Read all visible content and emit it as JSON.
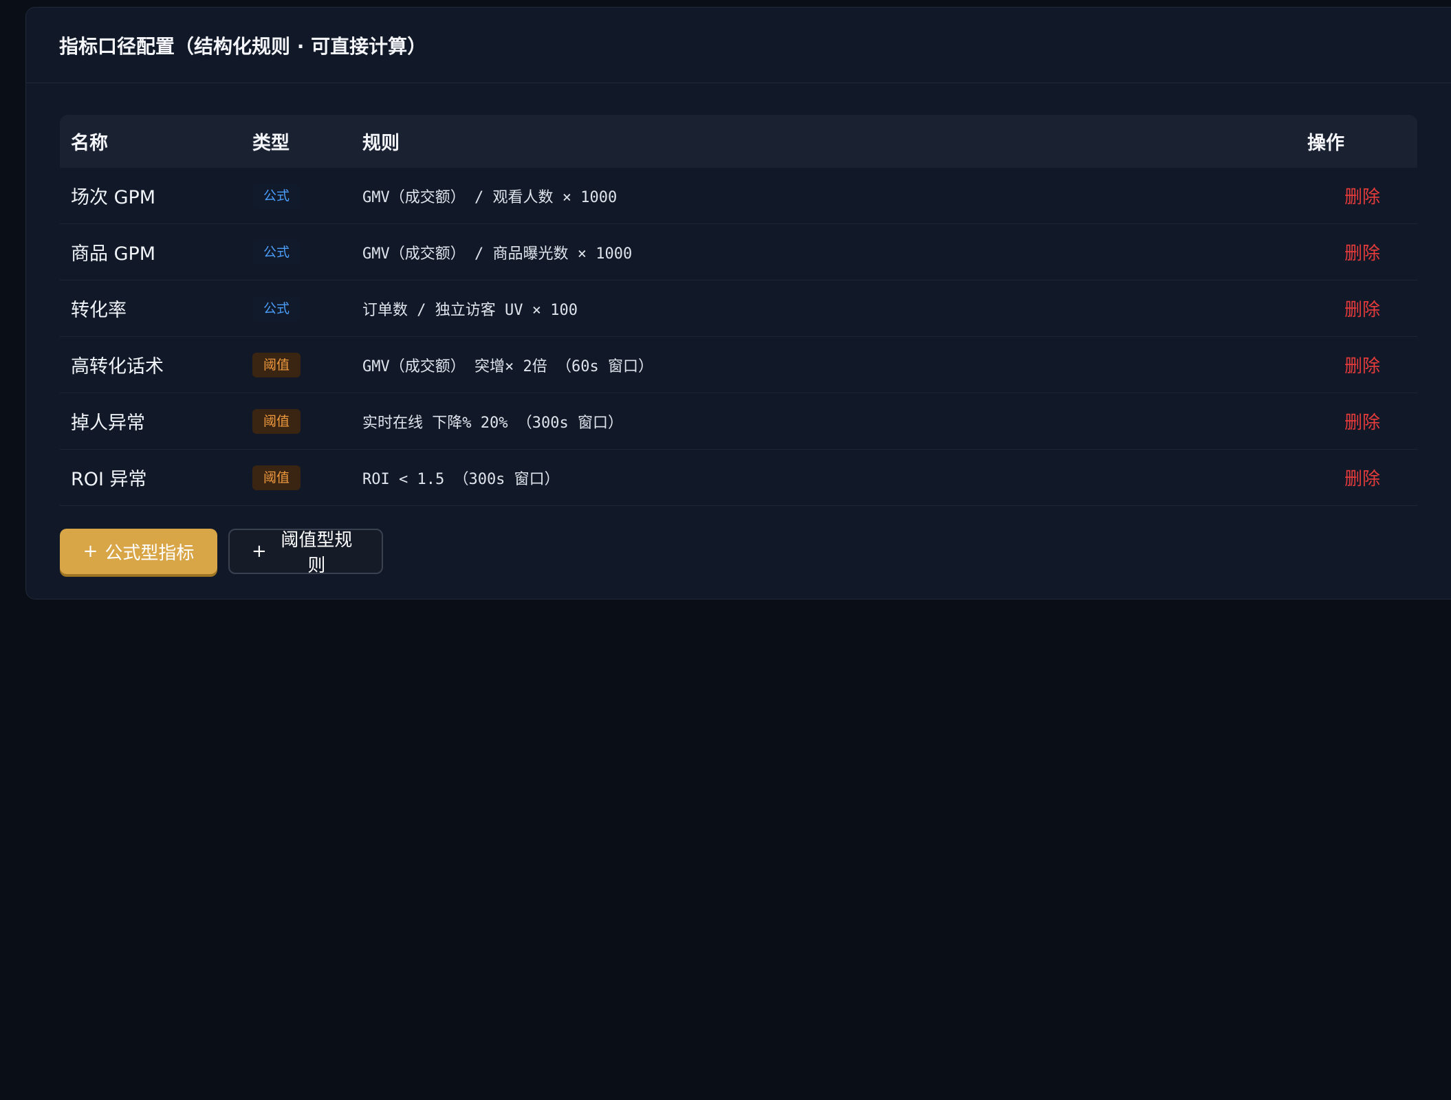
{
  "panel": {
    "title": "指标口径配置（结构化规则 · 可直接计算）"
  },
  "table": {
    "headers": {
      "name": "名称",
      "type": "类型",
      "rule": "规则",
      "op": "操作"
    },
    "rows": [
      {
        "name": "场次 GPM",
        "type": "公式",
        "kind": "formula",
        "rule": "GMV（成交额） / 观看人数 × 1000",
        "action": "删除"
      },
      {
        "name": "商品 GPM",
        "type": "公式",
        "kind": "formula",
        "rule": "GMV（成交额） / 商品曝光数 × 1000",
        "action": "删除"
      },
      {
        "name": "转化率",
        "type": "公式",
        "kind": "formula",
        "rule": "订单数 / 独立访客 UV × 100",
        "action": "删除"
      },
      {
        "name": "高转化话术",
        "type": "阈值",
        "kind": "threshold",
        "rule": "GMV（成交额） 突增× 2倍 （60s 窗口）",
        "action": "删除"
      },
      {
        "name": "掉人异常",
        "type": "阈值",
        "kind": "threshold",
        "rule": "实时在线 下降% 20% （300s 窗口）",
        "action": "删除"
      },
      {
        "name": "ROI 异常",
        "type": "阈值",
        "kind": "threshold",
        "rule": "ROI < 1.5 （300s 窗口）",
        "action": "删除"
      }
    ]
  },
  "actions": {
    "add_formula": "公式型指标",
    "add_threshold": "阈值型规则",
    "plus": "+"
  }
}
